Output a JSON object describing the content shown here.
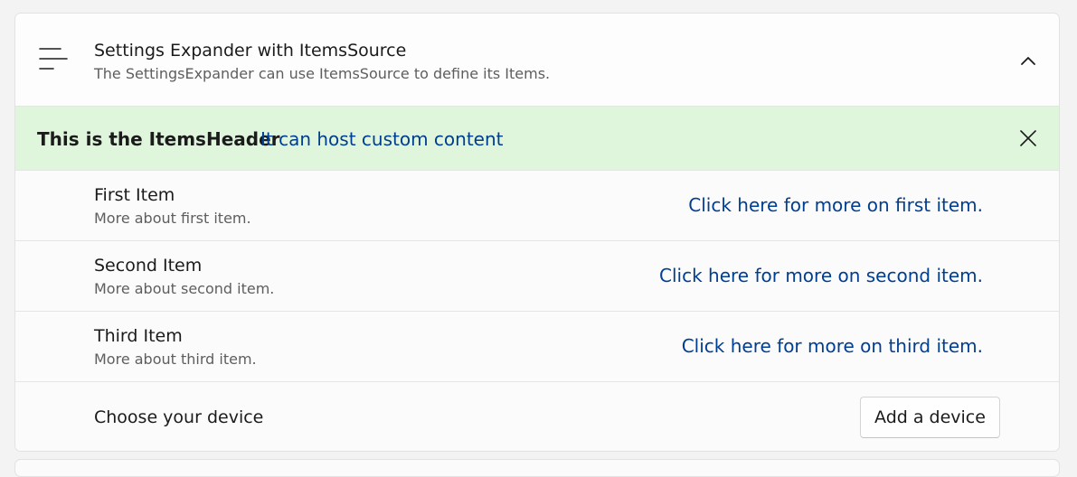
{
  "expander": {
    "title": "Settings Expander with ItemsSource",
    "description": "The SettingsExpander can use ItemsSource to define its Items.",
    "header_icon": "align-left-icon",
    "toggle_icon": "chevron-up-icon"
  },
  "items_header": {
    "title": "This is the ItemsHeader",
    "link": "It can host custom content",
    "close_icon": "close-icon",
    "background": "#dff6dd"
  },
  "items": [
    {
      "title": "First Item",
      "description": "More about first item.",
      "link": "Click here for more on first item."
    },
    {
      "title": "Second Item",
      "description": "More about second item.",
      "link": "Click here for more on second item."
    },
    {
      "title": "Third Item",
      "description": "More about third item.",
      "link": "Click here for more on third item."
    }
  ],
  "device_row": {
    "label": "Choose your device",
    "button": "Add a device"
  },
  "colors": {
    "link": "#003e92",
    "secondary_text": "#5e5e5e",
    "primary_text": "#1b1b1b"
  }
}
